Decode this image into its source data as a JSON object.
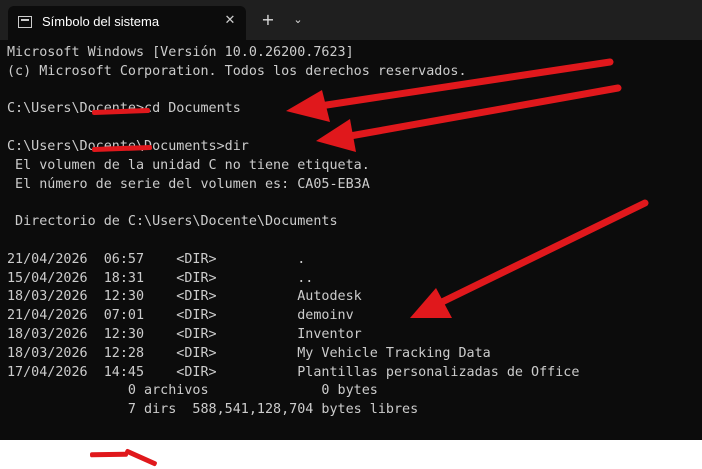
{
  "window": {
    "tab_title": "Símbolo del sistema",
    "tab_close_icon": "close-icon",
    "new_tab_icon": "plus-icon",
    "dropdown_icon": "chevron-down-icon",
    "terminal_icon": "terminal-icon"
  },
  "terminal": {
    "lines": [
      "Microsoft Windows [Versión 10.0.26200.7623]",
      "(c) Microsoft Corporation. Todos los derechos reservados.",
      "",
      "C:\\Users\\Docente>cd Documents",
      "",
      "C:\\Users\\Docente\\Documents>dir",
      " El volumen de la unidad C no tiene etiqueta.",
      " El número de serie del volumen es: CA05-EB3A",
      "",
      " Directorio de C:\\Users\\Docente\\Documents",
      "",
      "21/04/2026  06:57    <DIR>          .",
      "15/04/2026  18:31    <DIR>          ..",
      "18/03/2026  12:30    <DIR>          Autodesk",
      "21/04/2026  07:01    <DIR>          demoinv",
      "18/03/2026  12:30    <DIR>          Inventor",
      "18/03/2026  12:28    <DIR>          My Vehicle Tracking Data",
      "17/04/2026  14:45    <DIR>          Plantillas personalizadas de Office",
      "               0 archivos              0 bytes",
      "               7 dirs  588,541,128,704 bytes libres"
    ]
  },
  "colors": {
    "terminal_bg": "#0c0c0c",
    "titlebar_bg": "#1f1f1f",
    "text": "#cccccc",
    "annotation_red": "#e0181c"
  }
}
